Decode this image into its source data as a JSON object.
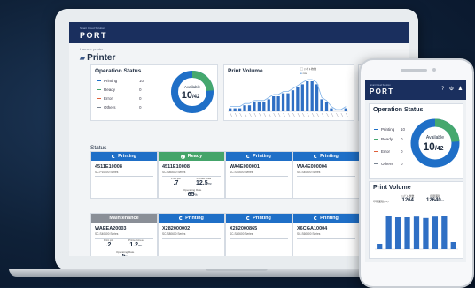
{
  "app": {
    "logo_sub": "Smart Cloud Solution",
    "logo": "PORT"
  },
  "breadcrumb": "Home > printer",
  "page_title": "Printer",
  "operation_status": {
    "title": "Operation Status",
    "items": [
      {
        "label": "Printing",
        "count": "10",
        "color": "#1f6fc7"
      },
      {
        "label": "Ready",
        "count": "0",
        "color": "#45a86e"
      },
      {
        "label": "Error",
        "count": "0",
        "color": "#e0603a"
      },
      {
        "label": "Others",
        "count": "0",
        "color": "#7a8593"
      }
    ],
    "donut_label": "Available",
    "available": "10",
    "total": "/42",
    "available_fraction": 0.238
  },
  "print_volume": {
    "title": "Print Volume",
    "legend": [
      "ｼﾝｸﾞﾙ 枚数",
      "n/a"
    ]
  },
  "report_title_partial": "R",
  "status_section_label": "Status",
  "status_cards": [
    {
      "state": "Printing",
      "id": "4511E10008",
      "series": "SC-P10000 Series",
      "color": "#1f6fc7",
      "icon": "spinner-icon"
    },
    {
      "state": "Ready",
      "id": "4511E10008",
      "series": "SC-S80600 Series",
      "color": "#44a46a",
      "icon": "check-icon",
      "m1_label": "Print job",
      "m1_value": ".7",
      "m2_label": "Printed Area",
      "m2_value": "12.5",
      "m2_unit": "m²",
      "m3_label": "Operating Rate",
      "m3_value": "65",
      "m3_unit": "%"
    },
    {
      "state": "Printing",
      "id": "WA4E000001",
      "series": "SC-S40600 Series",
      "color": "#1f6fc7",
      "icon": "spinner-icon"
    },
    {
      "state": "Printing",
      "id": "WA4E000004",
      "series": "SC-S40600 Series",
      "color": "#1f6fc7",
      "icon": "spinner-icon"
    },
    {
      "state": "Maintenance",
      "id": "WAEEA20003",
      "series": "SC-S40600 Series",
      "color": "#8a8f97",
      "icon": "",
      "m1_label": "Print job",
      "m1_value": ".2",
      "m2_label": "Printed Area",
      "m2_value": "1.2",
      "m2_unit": "m²",
      "m3_label": "Operating Rate",
      "m3_value": "5",
      "m3_unit": "%"
    },
    {
      "state": "Printing",
      "id": "X282000002",
      "series": "SC-S80600 Series",
      "color": "#1f6fc7",
      "icon": "spinner-icon"
    },
    {
      "state": "Printing",
      "id": "X282000865",
      "series": "SC-S80600 Series",
      "color": "#1f6fc7",
      "icon": "spinner-icon"
    },
    {
      "state": "Printing",
      "id": "X6CGA10004",
      "series": "SC-S60600 Series",
      "color": "#1f6fc7",
      "icon": "spinner-icon"
    }
  ],
  "chart_data": {
    "type": "bar",
    "title": "Print Volume",
    "values": [
      1,
      1,
      1,
      2,
      2,
      3,
      3,
      3,
      4,
      5,
      5,
      6,
      6,
      7,
      8,
      9,
      10,
      10,
      9,
      4,
      3,
      1,
      0,
      0,
      1
    ],
    "overlay_line": [
      1,
      1,
      1,
      2,
      2,
      3,
      3,
      3,
      4,
      5,
      5,
      6,
      6,
      7,
      8,
      9,
      10,
      10,
      9,
      4,
      3,
      1,
      0,
      0,
      1
    ],
    "ylim": [
      0,
      10
    ]
  },
  "mobile": {
    "logo_sub": "Smart Cloud Solution",
    "logo": "PORT",
    "operation_status_title": "Operation Status",
    "items": [
      {
        "label": "Printing",
        "count": "10"
      },
      {
        "label": "Ready",
        "count": "0"
      },
      {
        "label": "Error",
        "count": "0"
      },
      {
        "label": "Others",
        "count": "0"
      }
    ],
    "donut_label": "Available",
    "available": "10",
    "total": "/42",
    "print_volume_title": "Print Volume",
    "kpi_1_label": "ｼﾝｸﾞﾙ 枚数",
    "kpi_1_value": "1264",
    "kpi_2_label": "印刷面積",
    "kpi_2_value": "12640",
    "kpi_2_unit": "m²",
    "chart_label": "印刷面積(m²)",
    "bars": [
      0.15,
      0.95,
      0.9,
      0.9,
      0.92,
      0.88,
      0.92,
      0.95,
      0.2
    ]
  }
}
